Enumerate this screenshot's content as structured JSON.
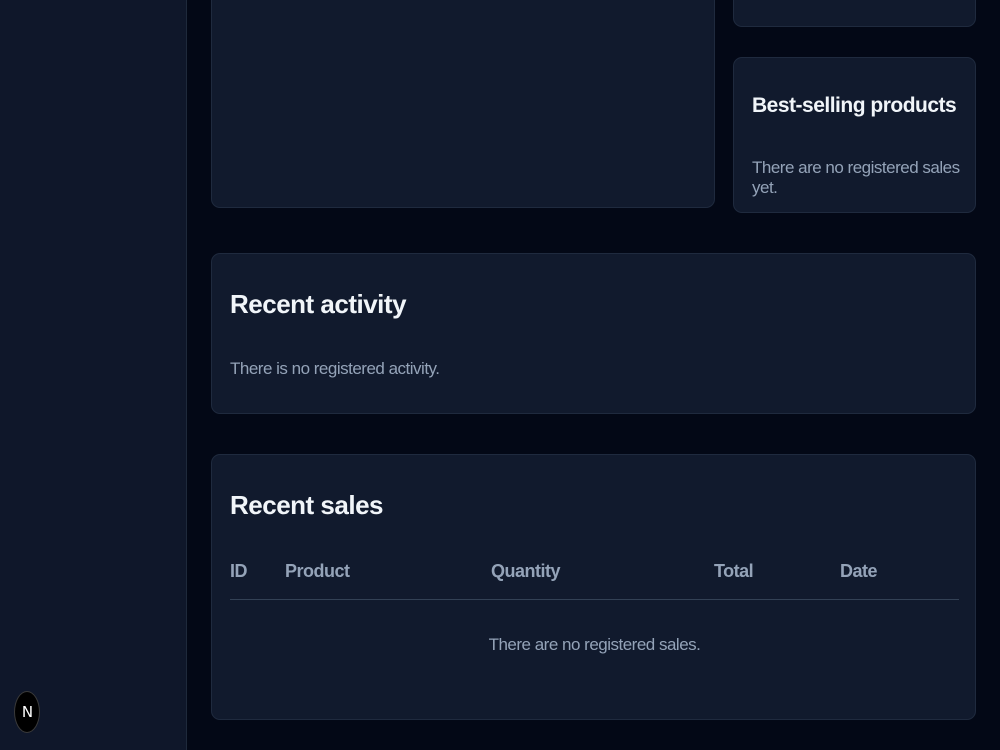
{
  "nextjs_badge": {
    "label": "N"
  },
  "best_selling": {
    "title": "Best-selling products",
    "empty_message": "There are no registered sales yet."
  },
  "recent_activity": {
    "title": "Recent activity",
    "empty_message": "There is no registered activity."
  },
  "recent_sales": {
    "title": "Recent sales",
    "columns": [
      "ID",
      "Product",
      "Quantity",
      "Total",
      "Date"
    ],
    "rows": [],
    "empty_message": "There are no registered sales."
  },
  "colors": {
    "page_background": "#030816",
    "card_background": "#111a2d",
    "sidebar_background": "#0f172a",
    "heading_text": "#f1f5f9",
    "muted_text": "#94a3b8"
  }
}
